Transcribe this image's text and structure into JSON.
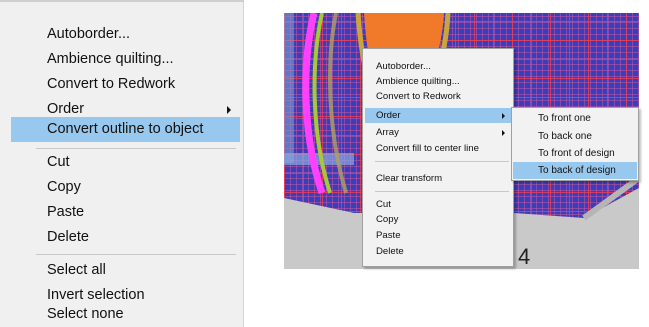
{
  "left_menu": {
    "items": [
      {
        "label": "Autoborder..."
      },
      {
        "label": "Ambience quilting..."
      },
      {
        "label": "Convert to Redwork"
      },
      {
        "label": "Order",
        "submenu": true
      },
      {
        "label": "Convert outline to object",
        "selected": true
      },
      {
        "label": "Cut"
      },
      {
        "label": "Copy"
      },
      {
        "label": "Paste"
      },
      {
        "label": "Delete"
      },
      {
        "label": "Select all"
      },
      {
        "label": "Invert selection"
      },
      {
        "label": "Select none"
      }
    ]
  },
  "context_menu": {
    "items": [
      {
        "label": "Autoborder..."
      },
      {
        "label": "Ambience quilting..."
      },
      {
        "label": "Convert to Redwork"
      },
      {
        "label": "Order",
        "submenu": true,
        "selected": true
      },
      {
        "label": "Array",
        "submenu": true
      },
      {
        "label": "Convert fill to center line"
      },
      {
        "label": "Clear transform"
      },
      {
        "label": "Cut"
      },
      {
        "label": "Copy"
      },
      {
        "label": "Paste"
      },
      {
        "label": "Delete"
      }
    ]
  },
  "order_submenu": {
    "items": [
      {
        "label": "To front one"
      },
      {
        "label": "To back one"
      },
      {
        "label": "To front of design"
      },
      {
        "label": "To back of design",
        "selected": true
      }
    ]
  },
  "canvas": {
    "label_4": "4"
  },
  "colors": {
    "menu_bg": "#f0f0f0",
    "highlight": "#98c8ee",
    "canvas_blue": "#3a3fb8",
    "grid_red": "#eb3c50",
    "orange": "#f07a2a",
    "magenta": "#ff40ff",
    "gray": "#c9c9c9"
  }
}
